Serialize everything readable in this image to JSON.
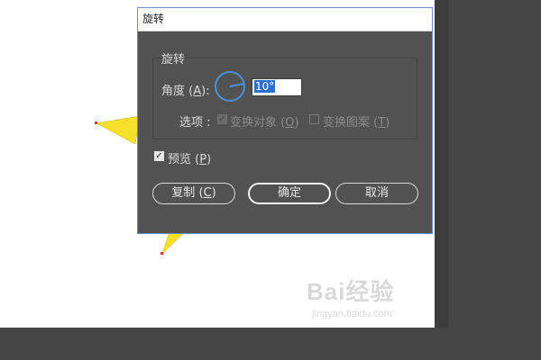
{
  "dialog": {
    "title": "旋转",
    "group_label": "旋转",
    "angle": {
      "label": "角度",
      "hotkey": "A",
      "value": "10°"
    },
    "options": {
      "label": "选项 :",
      "transform_objects": {
        "label": "变换对象",
        "hotkey": "O",
        "checked": true,
        "enabled": false
      },
      "transform_patterns": {
        "label": "变换图案",
        "hotkey": "T",
        "checked": false,
        "enabled": false
      }
    },
    "preview": {
      "label": "预览",
      "hotkey": "P",
      "checked": true
    },
    "buttons": {
      "copy": {
        "label": "复制",
        "hotkey": "C"
      },
      "ok": {
        "label": "确定"
      },
      "cancel": {
        "label": "取消"
      }
    }
  },
  "watermark": {
    "logo": "Bai经验",
    "url": "jingyan.baidu.com"
  },
  "colors": {
    "dialog_bg": "#525252",
    "app_dark": "#454545",
    "accent_blue": "#4a90d9",
    "shape_fill": "#f5e12a"
  }
}
